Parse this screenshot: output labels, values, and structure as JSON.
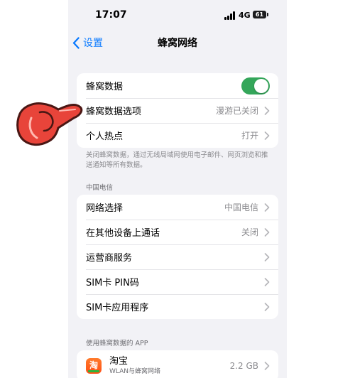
{
  "status": {
    "time": "17:07",
    "network": "4G",
    "battery": "61"
  },
  "nav": {
    "back_label": "设置",
    "title": "蜂窝网络"
  },
  "main_group": {
    "cellular_data": {
      "label": "蜂窝数据",
      "toggle_on": true
    },
    "data_options": {
      "label": "蜂窝数据选项",
      "value": "漫游已关闭"
    },
    "hotspot": {
      "label": "个人热点",
      "value": "打开"
    }
  },
  "footnote": "关闭蜂窝数据，通过无线局域网使用电子邮件、网页浏览和推送通知等所有数据。",
  "carrier_header": "中国电信",
  "carrier_group": {
    "network_select": {
      "label": "网络选择",
      "value": "中国电信"
    },
    "calls_other_devices": {
      "label": "在其他设备上通话",
      "value": "关闭"
    },
    "carrier_services": {
      "label": "运营商服务"
    },
    "sim_pin": {
      "label": "SIM卡 PIN码"
    },
    "sim_apps": {
      "label": "SIM卡应用程序"
    }
  },
  "apps_header": "使用蜂窝数据的 APP",
  "apps": [
    {
      "name": "淘宝",
      "subtitle": "WLAN与蜂窝网络",
      "usage": "2.2 GB",
      "icon_char": "淘"
    }
  ],
  "colors": {
    "accent": "#0a7aff",
    "toggle": "#34a65a",
    "pointer": "#e8443a"
  }
}
